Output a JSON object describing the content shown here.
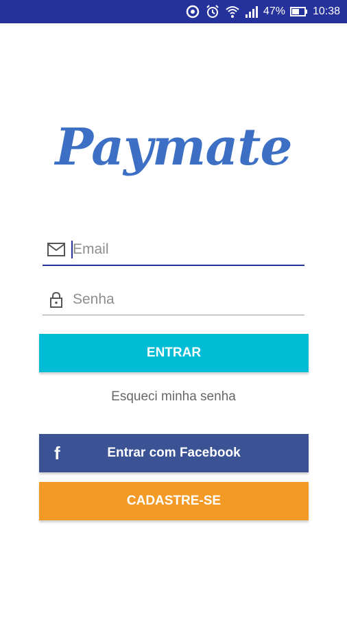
{
  "status_bar": {
    "battery": "47%",
    "time": "10:38",
    "icons": [
      "sync-icon",
      "alarm-icon",
      "wifi-icon",
      "signal-icon",
      "battery-icon"
    ]
  },
  "logo": {
    "text": "Paymate",
    "color": "#3d6fc4"
  },
  "form": {
    "email": {
      "placeholder": "Email",
      "value": "",
      "icon": "mail-icon"
    },
    "password": {
      "placeholder": "Senha",
      "value": "",
      "icon": "lock-icon"
    }
  },
  "buttons": {
    "login": "ENTRAR",
    "forgot": "Esqueci minha senha",
    "facebook": "Entrar com Facebook",
    "facebook_icon": "f",
    "signup": "CADASTRE-SE"
  },
  "colors": {
    "status_bar": "#25329b",
    "login": "#00bcd4",
    "facebook": "#3b5294",
    "signup": "#f39a26"
  }
}
